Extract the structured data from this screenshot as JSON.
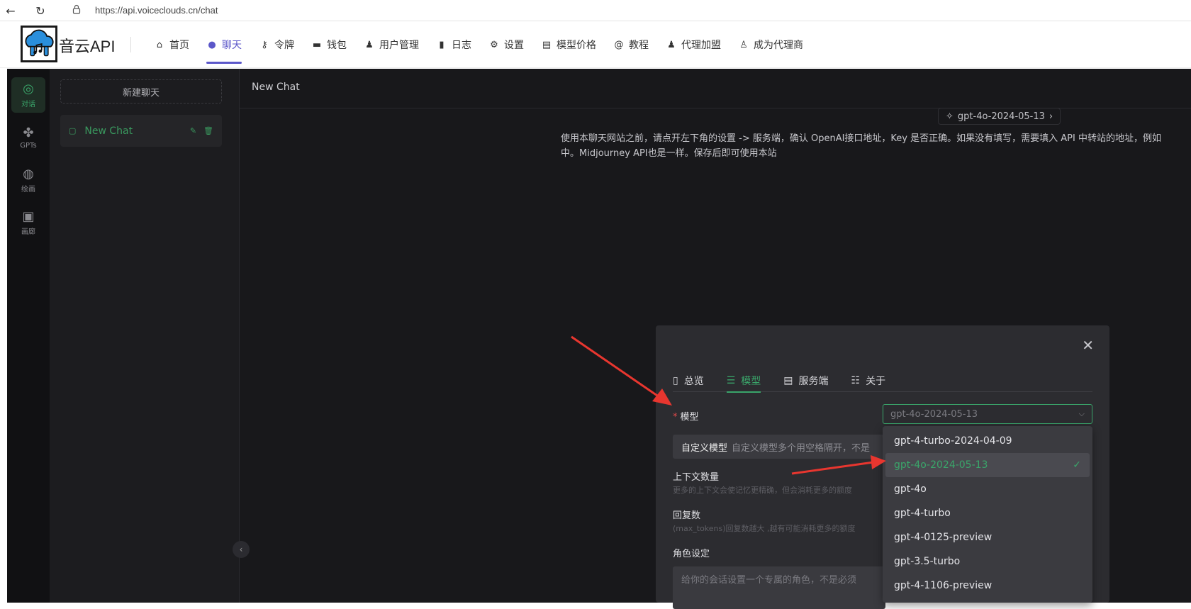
{
  "browser": {
    "url": "https://api.voiceclouds.cn/chat"
  },
  "brand": {
    "name": "音云API"
  },
  "nav": {
    "items": [
      {
        "label": "首页",
        "icon": "home-icon",
        "active": false
      },
      {
        "label": "聊天",
        "icon": "chat-icon",
        "active": true
      },
      {
        "label": "令牌",
        "icon": "key-icon",
        "active": false
      },
      {
        "label": "钱包",
        "icon": "wallet-icon",
        "active": false
      },
      {
        "label": "用户管理",
        "icon": "user-icon",
        "active": false
      },
      {
        "label": "日志",
        "icon": "chart-icon",
        "active": false
      },
      {
        "label": "设置",
        "icon": "gear-icon",
        "active": false
      },
      {
        "label": "模型价格",
        "icon": "price-icon",
        "active": false
      },
      {
        "label": "教程",
        "icon": "at-icon",
        "active": false
      },
      {
        "label": "代理加盟",
        "icon": "users-icon",
        "active": false
      },
      {
        "label": "成为代理商",
        "icon": "user-plus-icon",
        "active": false
      }
    ]
  },
  "rail": {
    "items": [
      {
        "label": "对话",
        "icon": "chat-bubbles-icon",
        "active": true
      },
      {
        "label": "GPTs",
        "icon": "grid-icon",
        "active": false
      },
      {
        "label": "绘画",
        "icon": "palette-icon",
        "active": false
      },
      {
        "label": "画廊",
        "icon": "image-icon",
        "active": false
      }
    ]
  },
  "sidebar": {
    "new_chat_label": "新建聊天",
    "chats": [
      {
        "title": "New Chat"
      }
    ]
  },
  "main": {
    "title": "New Chat",
    "model_chip": "gpt-4o-2024-05-13",
    "notice_line1": "使用本聊天网站之前，请点开左下角的设置 -> 服务端，确认 OpenAI接口地址，Key 是否正确。如果没有填写，需要填入 API 中转站的地址，例如",
    "notice_line2": "中。Midjourney API也是一样。保存后即可使用本站"
  },
  "settings_modal": {
    "tabs": [
      {
        "label": "总览",
        "icon": "doc-icon",
        "active": false
      },
      {
        "label": "模型",
        "icon": "sliders-icon",
        "active": true
      },
      {
        "label": "服务端",
        "icon": "server-icon",
        "active": false
      },
      {
        "label": "关于",
        "icon": "list-icon",
        "active": false
      }
    ],
    "model_label": "模型",
    "model_value": "gpt-4o-2024-05-13",
    "custom_model_label": "自定义模型",
    "custom_model_placeholder": "自定义模型多个用空格隔开，不是",
    "context_label": "上下文数量",
    "context_hint": "更多的上下文会使记忆更精确，但会消耗更多的额度",
    "reply_label": "回复数",
    "reply_hint": "(max_tokens)回复数越大 ,越有可能消耗更多的额度",
    "role_label": "角色设定",
    "role_placeholder": "给你的会话设置一个专属的角色，不是必须"
  },
  "model_dropdown": {
    "options": [
      "gpt-4-turbo-2024-04-09",
      "gpt-4o-2024-05-13",
      "gpt-4o",
      "gpt-4-turbo",
      "gpt-4-0125-preview",
      "gpt-3.5-turbo",
      "gpt-4-1106-preview"
    ],
    "selected": "gpt-4o-2024-05-13"
  },
  "colors": {
    "accent_purple": "#5b57c9",
    "accent_green": "#3aa56a",
    "annotation_red": "#e8362f",
    "app_bg": "#18181b"
  }
}
